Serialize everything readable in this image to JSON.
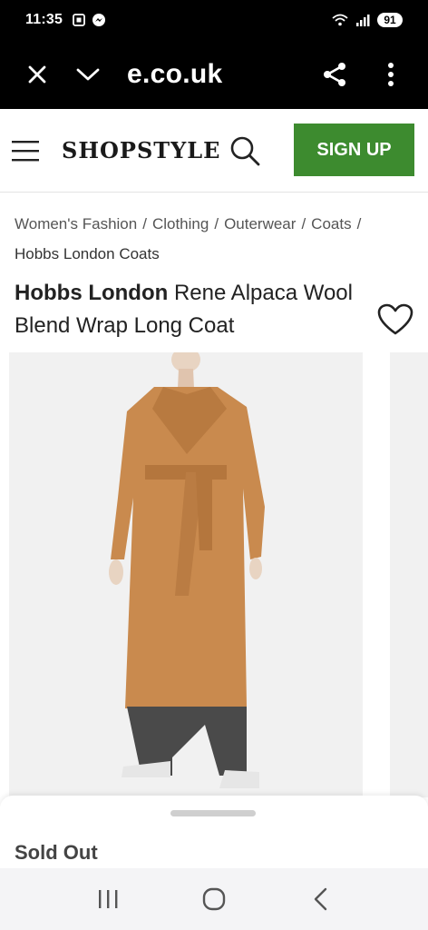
{
  "status_bar": {
    "time": "11:35",
    "battery": "91"
  },
  "browser": {
    "url": "e.co.uk"
  },
  "header": {
    "logo": "SHOPSTYLE",
    "signup_label": "SIGN UP"
  },
  "breadcrumb": {
    "items": [
      "Women's Fashion",
      "Clothing",
      "Outerwear",
      "Coats"
    ],
    "separator": "/",
    "current": "Hobbs London Coats"
  },
  "product": {
    "brand": "Hobbs London",
    "name": " Rene Alpaca Wool Blend Wrap Long Coat"
  },
  "sheet": {
    "status": "Sold Out"
  },
  "colors": {
    "signup_bg": "#3d8b2f",
    "coat": "#c98a4e",
    "trousers": "#4a4a4a"
  },
  "icons": [
    "close-icon",
    "chevron-down-icon",
    "share-icon",
    "more-vert-icon",
    "menu-icon",
    "search-icon",
    "heart-icon",
    "recents-icon",
    "home-icon",
    "back-icon"
  ]
}
